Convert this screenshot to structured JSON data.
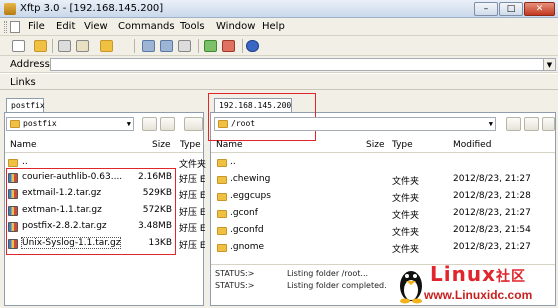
{
  "window": {
    "title": "Xftp 3.0 - [192.168.145.200]",
    "minimize": "–",
    "maximize": "□",
    "close": "✕"
  },
  "menu": [
    "File",
    "Edit",
    "View",
    "Commands",
    "Tools",
    "Window",
    "Help"
  ],
  "address": {
    "label": "Address",
    "value": ""
  },
  "links": {
    "label": "Links"
  },
  "left_pane": {
    "tab": "postfix",
    "path": "postfix",
    "columns": {
      "name": "Name",
      "size": "Size",
      "type": "Type"
    },
    "rows": [
      {
        "name": "..",
        "size": "",
        "type": "文件夹"
      },
      {
        "name": "courier-authlib-0.63....",
        "size": "2.16MB",
        "type": "好压 E"
      },
      {
        "name": "extmail-1.2.tar.gz",
        "size": "529KB",
        "type": "好压 E"
      },
      {
        "name": "extman-1.1.tar.gz",
        "size": "572KB",
        "type": "好压 E"
      },
      {
        "name": "postfix-2.8.2.tar.gz",
        "size": "3.48MB",
        "type": "好压 E"
      },
      {
        "name": "Unix-Syslog-1.1.tar.gz",
        "size": "13KB",
        "type": "好压 E"
      }
    ]
  },
  "right_pane": {
    "tab": "192.168.145.200",
    "path": "/root",
    "columns": {
      "name": "Name",
      "size": "Size",
      "type": "Type",
      "modified": "Modified"
    },
    "rows": [
      {
        "name": "..",
        "size": "",
        "type": "",
        "modified": ""
      },
      {
        "name": ".chewing",
        "size": "",
        "type": "文件夹",
        "modified": "2012/8/23, 21:27"
      },
      {
        "name": ".eggcups",
        "size": "",
        "type": "文件夹",
        "modified": "2012/8/23, 21:28"
      },
      {
        "name": ".gconf",
        "size": "",
        "type": "文件夹",
        "modified": "2012/8/23, 21:27"
      },
      {
        "name": ".gconfd",
        "size": "",
        "type": "文件夹",
        "modified": "2012/8/23, 21:54"
      },
      {
        "name": ".gnome",
        "size": "",
        "type": "文件夹",
        "modified": "2012/8/23, 21:27"
      }
    ]
  },
  "status": {
    "lines": [
      {
        "label": "STATUS:>",
        "text": "Listing folder /root..."
      },
      {
        "label": "STATUS:>",
        "text": "Listing folder completed."
      }
    ]
  },
  "watermark": {
    "brand": "Linux",
    "brand2": "社区",
    "url": "www.Linuxidc.com"
  },
  "colors": {
    "highlight_box": "#e0262c",
    "title_gradient_top": "#eaf0f8"
  }
}
